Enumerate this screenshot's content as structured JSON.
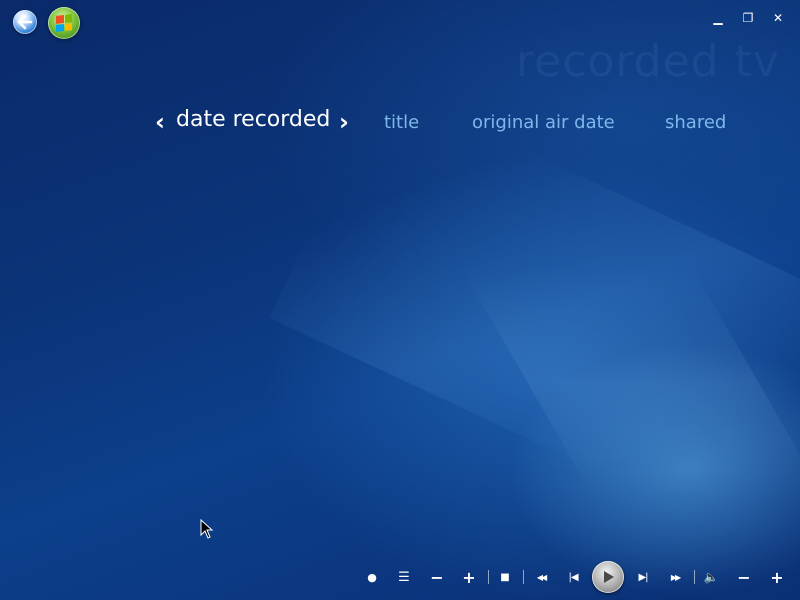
{
  "app": {
    "section_watermark": "recorded tv"
  },
  "top_left": {
    "back_icon": "back-arrow-icon",
    "start_icon": "windows-start-icon"
  },
  "window_controls": {
    "minimize_glyph": "▁",
    "restore_glyph": "❐",
    "close_glyph": "✕"
  },
  "pivot": {
    "prev_glyph": "‹",
    "next_glyph": "›",
    "current": "date recorded",
    "items": [
      "title",
      "original air date",
      "shared"
    ],
    "active_color": "#ffffff",
    "inactive_color": "#7fb7ea"
  },
  "transport": {
    "buttons": [
      {
        "name": "record-icon",
        "glyph": "●"
      },
      {
        "name": "guide-list-icon",
        "glyph": "☰"
      },
      {
        "name": "channel-down-icon",
        "glyph": "−"
      },
      {
        "name": "channel-up-icon",
        "glyph": "+"
      },
      {
        "name": "stop-icon",
        "glyph": "■"
      },
      {
        "name": "rewind-icon",
        "glyph": "◀◀"
      },
      {
        "name": "skip-back-icon",
        "glyph": "|◀"
      },
      {
        "name": "play-icon",
        "glyph": "▶"
      },
      {
        "name": "skip-forward-icon",
        "glyph": "▶|"
      },
      {
        "name": "fast-forward-icon",
        "glyph": "▶▶"
      },
      {
        "name": "mute-icon",
        "glyph": "🔈"
      },
      {
        "name": "volume-down-icon",
        "glyph": "−"
      },
      {
        "name": "volume-up-icon",
        "glyph": "+"
      }
    ]
  },
  "colors": {
    "background": "#0b3478",
    "accent": "#7fb7ea"
  }
}
